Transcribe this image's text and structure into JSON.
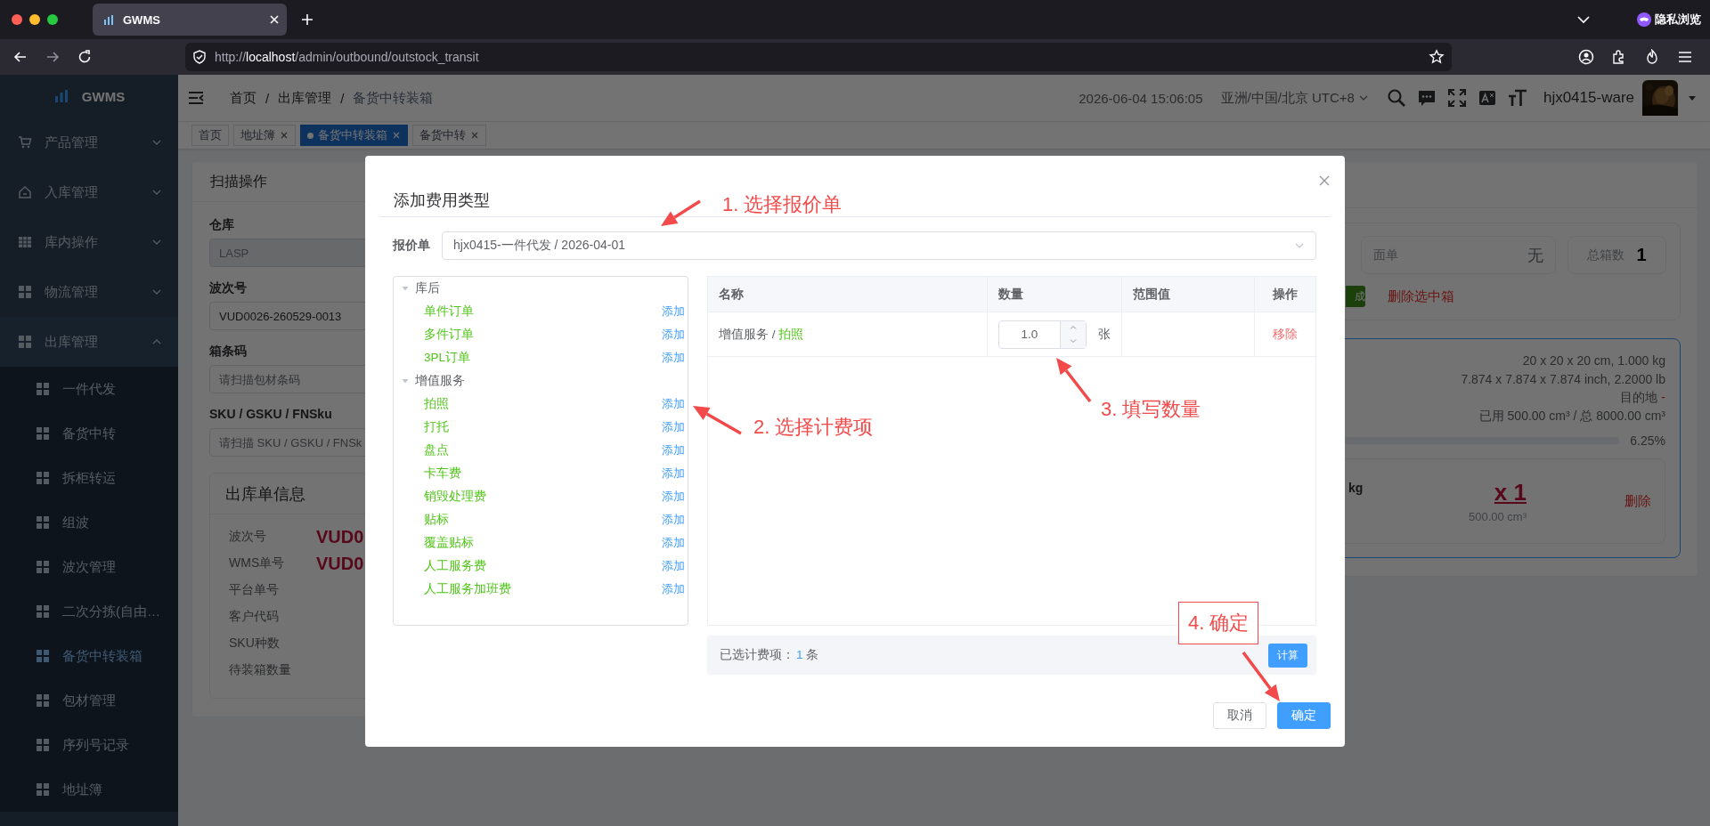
{
  "browser": {
    "tab_title": "GWMS",
    "private_label": "隐私浏览",
    "url": "http://**localhost**/admin/outbound/outstock_transit"
  },
  "sidebar": {
    "logo": "GWMS",
    "items": [
      {
        "label": "产品管理",
        "expanded": false
      },
      {
        "label": "入库管理",
        "expanded": false
      },
      {
        "label": "库内操作",
        "expanded": false
      },
      {
        "label": "物流管理",
        "expanded": false
      },
      {
        "label": "出库管理",
        "expanded": true,
        "children": [
          {
            "label": "一件代发",
            "selected": false
          },
          {
            "label": "备货中转",
            "selected": false
          },
          {
            "label": "拆柜转运",
            "selected": false
          },
          {
            "label": "组波",
            "selected": false
          },
          {
            "label": "波次管理",
            "selected": false
          },
          {
            "label": "二次分拣(自由…",
            "selected": false
          },
          {
            "label": "备货中转装箱",
            "selected": true
          },
          {
            "label": "包材管理",
            "selected": false
          },
          {
            "label": "序列号记录",
            "selected": false
          },
          {
            "label": "地址簿",
            "selected": false
          }
        ]
      }
    ]
  },
  "header": {
    "breadcrumb": [
      {
        "label": "首页",
        "kind": "link"
      },
      {
        "label": "/",
        "kind": "separator"
      },
      {
        "label": "出库管理",
        "kind": "link"
      },
      {
        "label": "/",
        "kind": "separator"
      },
      {
        "label": "备货中转装箱",
        "kind": "current"
      }
    ],
    "datetime": "2026-06-04 15:06:05",
    "timezone": "亚洲/中国/北京 UTC+8",
    "user": "hjx0415-ware"
  },
  "tags": [
    {
      "label": "首页",
      "selected": false,
      "closable": false
    },
    {
      "label": "地址簿",
      "selected": false,
      "closable": true
    },
    {
      "label": "备货中转装箱",
      "selected": true,
      "closable": true
    },
    {
      "label": "备货中转",
      "selected": false,
      "closable": true
    }
  ],
  "scan_card": {
    "title": "扫描操作",
    "fields": [
      {
        "label": "仓库",
        "value": "LASP",
        "disabled": true
      },
      {
        "label": "波次号",
        "value": "VUD0026-260529-0013",
        "disabled": false
      },
      {
        "label": "箱条码",
        "placeholder": "请扫描包材条码",
        "disabled": false
      },
      {
        "label": "SKU / GSKU / FNSku",
        "placeholder": "请扫描 SKU / GSKU / FNSk",
        "disabled": false
      }
    ]
  },
  "order_info": {
    "title": "出库单信息",
    "rows": [
      {
        "label": "波次号",
        "value": "VUD0"
      },
      {
        "label": "WMS单号",
        "value": "VUD0"
      },
      {
        "label": "平台单号"
      },
      {
        "label": "客户代码"
      },
      {
        "label": "SKU种数"
      },
      {
        "label": "待装箱数量"
      }
    ]
  },
  "box_panel": {
    "waybill_label": "面单",
    "waybill_value": "无",
    "total_label": "总箱数",
    "total_value": "1",
    "complete_button": "成",
    "delete_selected": "删除选中箱"
  },
  "box_card": {
    "lines": [
      "20 x 20 x 20 cm, 1.000 kg",
      "7.874 x 7.874 x 7.874 inch, 2.2000 lb"
    ],
    "destination_label": "目的地",
    "destination_value": "-",
    "usage": "已用 500.00 cm³ / 总 8000.00 cm³",
    "percent": "6.25%",
    "item": {
      "weight": "kg",
      "quantity": "x 1",
      "volume": "500.00 cm³",
      "delete": "删除"
    }
  },
  "dialog": {
    "title": "添加费用类型",
    "quote_label": "报价单",
    "quote_value": "hjx0415-一件代发 / 2026-04-01",
    "tree": [
      {
        "label": "库后",
        "expanded": true,
        "children": [
          {
            "label": "单件订单",
            "action": "添加"
          },
          {
            "label": "多件订单",
            "action": "添加"
          },
          {
            "label": "3PL订单",
            "action": "添加"
          }
        ]
      },
      {
        "label": "增值服务",
        "expanded": true,
        "children": [
          {
            "label": "拍照",
            "action": "添加"
          },
          {
            "label": "打托",
            "action": "添加"
          },
          {
            "label": "盘点",
            "action": "添加"
          },
          {
            "label": "卡车费",
            "action": "添加"
          },
          {
            "label": "销毁处理费",
            "action": "添加"
          },
          {
            "label": "贴标",
            "action": "添加"
          },
          {
            "label": "覆盖贴标",
            "action": "添加"
          },
          {
            "label": "人工服务费",
            "action": "添加"
          },
          {
            "label": "人工服务加班费",
            "action": "添加"
          }
        ]
      }
    ],
    "columns": [
      "名称",
      "数量",
      "范围值",
      "操作"
    ],
    "rows": [
      {
        "category": "增值服务 / ",
        "name": "拍照",
        "quantity": "1.0",
        "unit": "张",
        "action": "移除"
      }
    ],
    "summary": {
      "label": "已选计费项：",
      "count": "1",
      "unit": "条"
    },
    "calc_button": "计算",
    "buttons": [
      {
        "label": "取消",
        "kind": "default"
      },
      {
        "label": "确定",
        "kind": "primary"
      }
    ]
  },
  "annotations": [
    {
      "text": "1. 选择报价单",
      "kind": "plain"
    },
    {
      "text": "2. 选择计费项",
      "kind": "plain"
    },
    {
      "text": "3. 填写数量",
      "kind": "plain"
    },
    {
      "text": "4. 确定",
      "kind": "boxed"
    }
  ]
}
